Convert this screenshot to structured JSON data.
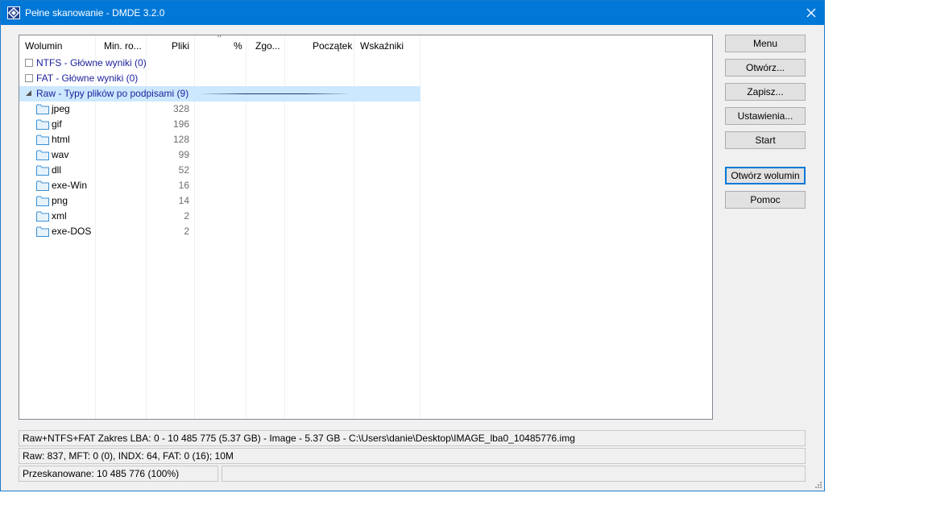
{
  "window": {
    "title": "Pełne skanowanie - DMDE 3.2.0"
  },
  "list": {
    "columns": [
      "Wolumin",
      "Min. ro...",
      "Pliki",
      "%",
      "Zgo...",
      "Początek",
      "Wskaźniki"
    ],
    "rows": [
      {
        "label": "NTFS - Główne wyniki (0)"
      },
      {
        "label": "FAT - Główne wyniki (0)"
      },
      {
        "label": "Raw - Typy plików po podpisami (9)"
      }
    ],
    "children": [
      {
        "name": "jpeg",
        "count": "328"
      },
      {
        "name": "gif",
        "count": "196"
      },
      {
        "name": "html",
        "count": "128"
      },
      {
        "name": "wav",
        "count": "99"
      },
      {
        "name": "dll",
        "count": "52"
      },
      {
        "name": "exe-Win",
        "count": "16"
      },
      {
        "name": "png",
        "count": "14"
      },
      {
        "name": "xml",
        "count": "2"
      },
      {
        "name": "exe-DOS",
        "count": "2"
      }
    ]
  },
  "buttons": {
    "menu": "Menu",
    "open": "Otwórz...",
    "save": "Zapisz...",
    "settings": "Ustawienia...",
    "start": "Start",
    "open_volume": "Otwórz wolumin",
    "help": "Pomoc"
  },
  "status": {
    "line1": "Raw+NTFS+FAT Zakres LBA: 0 - 10 485 775 (5.37 GB) - Image - 5.37 GB - C:\\Users\\danie\\Desktop\\IMAGE_lba0_10485776.img",
    "line2": "Raw: 837, MFT: 0 (0), INDX: 64, FAT: 0 (16); 10M",
    "scanned": "Przeskanowane: 10 485 776 (100%)",
    "extra": ""
  },
  "colors": {
    "titlebar": "#0078d7",
    "selection": "#cce8ff",
    "folder": "#4aa3df"
  }
}
